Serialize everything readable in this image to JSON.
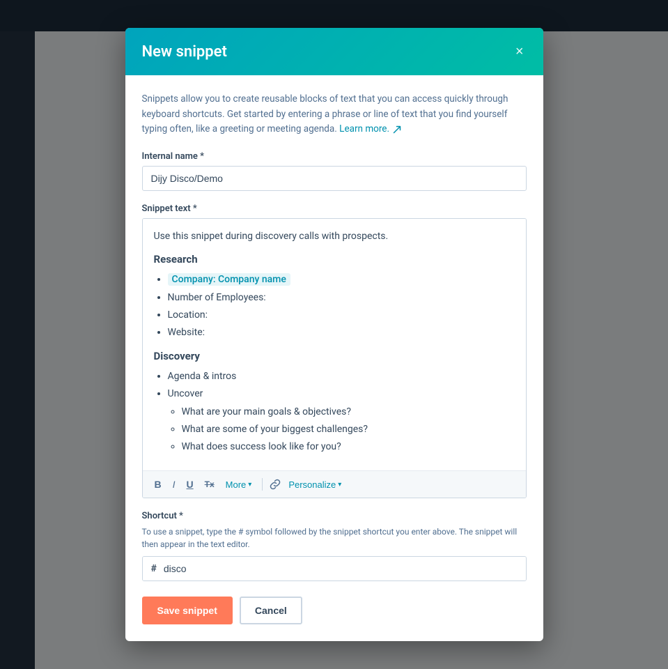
{
  "modal": {
    "title": "New snippet",
    "description": "Snippets allow you to create reusable blocks of text that you can access quickly through keyboard shortcuts. Get started by entering a phrase or line of text that you find yourself typing often, like a greeting or meeting agenda.",
    "learn_more_label": "Learn more.",
    "close_icon": "×",
    "internal_name_label": "Internal name *",
    "internal_name_value": "Dijy Disco/Demo",
    "snippet_text_label": "Snippet text *",
    "snippet_content": {
      "intro": "Use this snippet during discovery calls with prospects.",
      "section1_title": "Research",
      "items1": [
        {
          "text": "Company: Company name",
          "highlight": true
        },
        {
          "text": "Number of Employees:",
          "highlight": false
        },
        {
          "text": "Location:",
          "highlight": false
        },
        {
          "text": "Website:",
          "highlight": false
        }
      ],
      "section2_title": "Discovery",
      "items2": [
        {
          "text": "Agenda & intros",
          "sub": []
        },
        {
          "text": "Uncover",
          "sub": [
            "What are your main goals & objectives?",
            "What are some of your biggest challenges?",
            "What does success look like for you?"
          ]
        }
      ]
    },
    "toolbar": {
      "bold": "B",
      "italic": "I",
      "underline": "U",
      "strikethrough": "Tx",
      "more_label": "More",
      "personalize_label": "Personalize"
    },
    "shortcut_label": "Shortcut *",
    "shortcut_help": "To use a snippet, type the # symbol followed by the snippet shortcut you enter above. The snippet will then appear in the text editor.",
    "shortcut_hash": "#",
    "shortcut_value": "disco",
    "save_button": "Save snippet",
    "cancel_button": "Cancel"
  }
}
